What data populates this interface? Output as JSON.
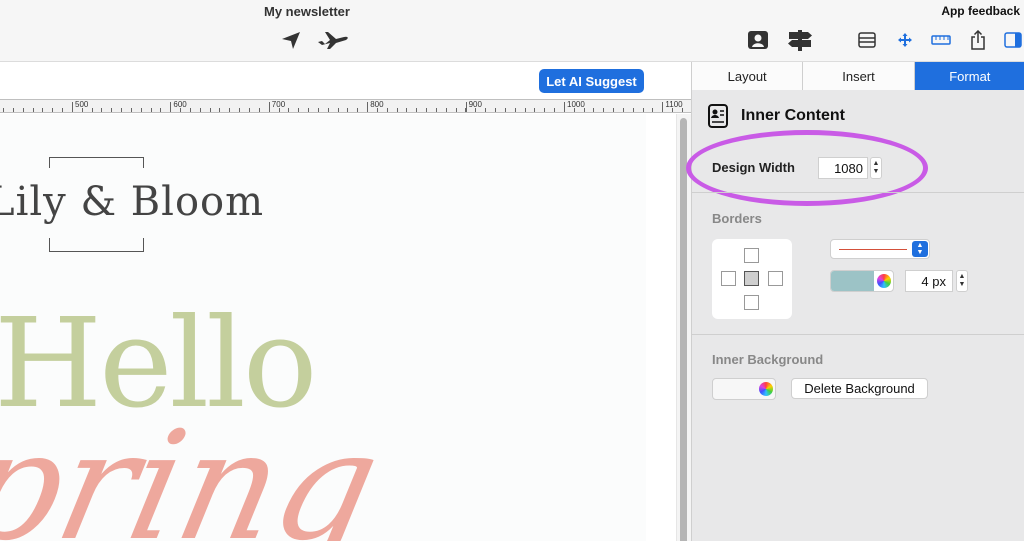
{
  "toolbar": {
    "title": "My newsletter",
    "app_feedback": "App feedback",
    "icons": [
      "send-icon",
      "plane-icon",
      "contacts-icon",
      "signpost-icon",
      "layout-view-icon",
      "move-icon",
      "ruler-icon",
      "share-icon",
      "sidebar-toggle-icon"
    ]
  },
  "canvas": {
    "ai_button_label": "Let AI Suggest",
    "ruler_labels": [
      "500",
      "600",
      "700",
      "800",
      "900",
      "1000",
      "1100"
    ],
    "logo_text": "Lily & Bloom",
    "headline": "Hello",
    "script_word": "pring"
  },
  "inspector": {
    "tabs": [
      {
        "label": "Layout",
        "active": false
      },
      {
        "label": "Insert",
        "active": false
      },
      {
        "label": "Format",
        "active": true
      }
    ],
    "section_title": "Inner Content",
    "design_width": {
      "label": "Design Width",
      "value": "1080"
    },
    "borders": {
      "label": "Borders",
      "line_color": "#d4503a",
      "color": "#9cc3c6",
      "width": "4 px"
    },
    "inner_background": {
      "label": "Inner Background",
      "delete_label": "Delete Background"
    }
  },
  "colors": {
    "accent": "#1f6fde",
    "highlight": "#c95be6",
    "hello_green": "#c4cf9d",
    "spring_pink": "#eea89d"
  }
}
